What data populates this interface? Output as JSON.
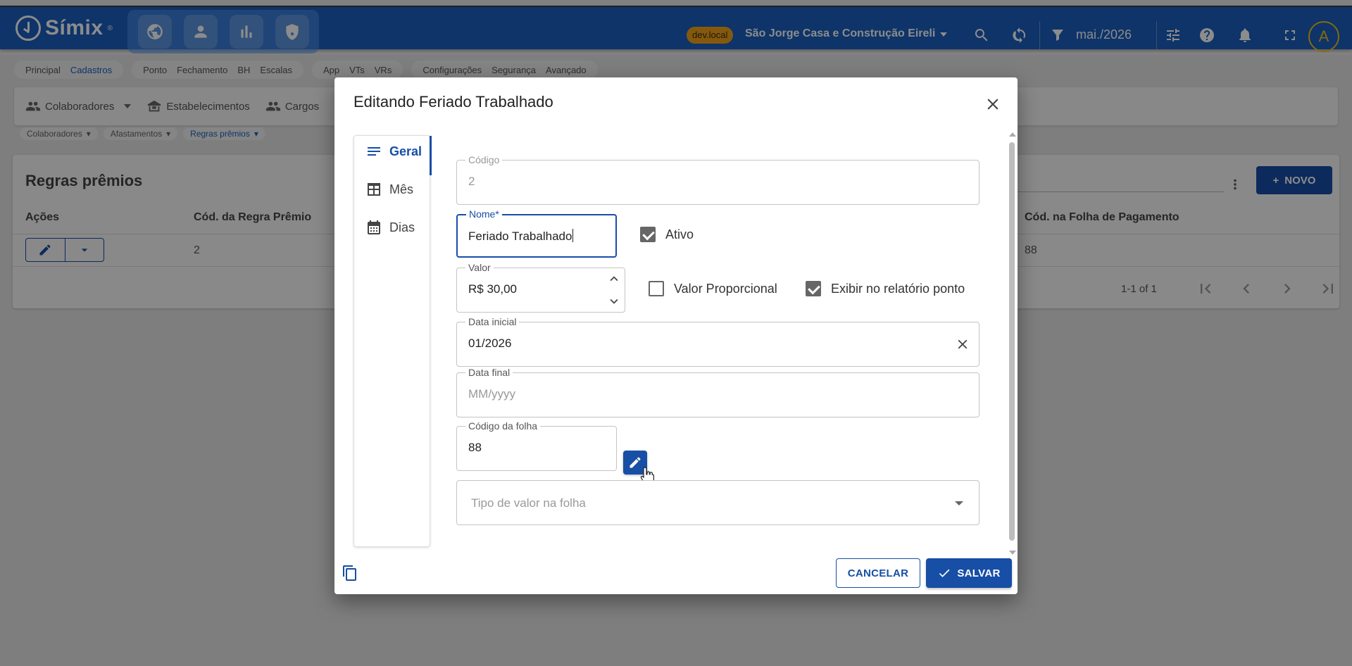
{
  "app": {
    "logo": "Símix",
    "logo_reg": "®",
    "env_badge": "dev.local",
    "company": "São Jorge Casa e Construção Eireli",
    "period": "mai./2026",
    "avatar_letter": "A"
  },
  "menu_groups": [
    [
      "Principal",
      "Cadastros"
    ],
    [
      "Ponto",
      "Fechamento",
      "BH",
      "Escalas"
    ],
    [
      "App",
      "VTs",
      "VRs"
    ],
    [
      "Configurações",
      "Segurança",
      "Avançado"
    ]
  ],
  "subnav": {
    "colaboradores": "Colaboradores",
    "estabelecimentos": "Estabelecimentos",
    "cargos": "Cargos"
  },
  "crumbs": [
    "Colaboradores",
    "Afastamentos",
    "Regras prêmios"
  ],
  "page": {
    "title": "Regras prêmios",
    "new_button": "NOVO",
    "columns": {
      "acoes": "Ações",
      "cod_regra": "Cód. da Regra Prêmio",
      "cod_folha": "Cód. na Folha de Pagamento"
    },
    "row": {
      "cod_regra": "2",
      "cod_folha": "88"
    },
    "pagination": "1-1 of 1"
  },
  "dialog": {
    "title": "Editando Feriado Trabalhado",
    "tabs": [
      "Geral",
      "Mês",
      "Dias"
    ],
    "fields": {
      "codigo": {
        "label": "Código",
        "value": "2"
      },
      "nome": {
        "label": "Nome*",
        "value": "Feriado Trabalhado"
      },
      "ativo": {
        "label": "Ativo",
        "checked": true
      },
      "valor": {
        "label": "Valor",
        "value": "R$ 30,00"
      },
      "valor_proporcional": {
        "label": "Valor Proporcional",
        "checked": false
      },
      "exibir_relatorio": {
        "label": "Exibir no relatório ponto",
        "checked": true
      },
      "data_inicial": {
        "label": "Data inicial",
        "value": "01/2026"
      },
      "data_final": {
        "label": "Data final",
        "placeholder": "MM/yyyy"
      },
      "codigo_folha": {
        "label": "Código da folha",
        "value": "88"
      },
      "tipo_valor": {
        "placeholder": "Tipo de valor na folha"
      }
    },
    "cancel": "CANCELAR",
    "save": "SALVAR"
  },
  "colors": {
    "primary": "#174ea6",
    "appbar": "#1a5fc0",
    "badge": "#f0a21b"
  }
}
